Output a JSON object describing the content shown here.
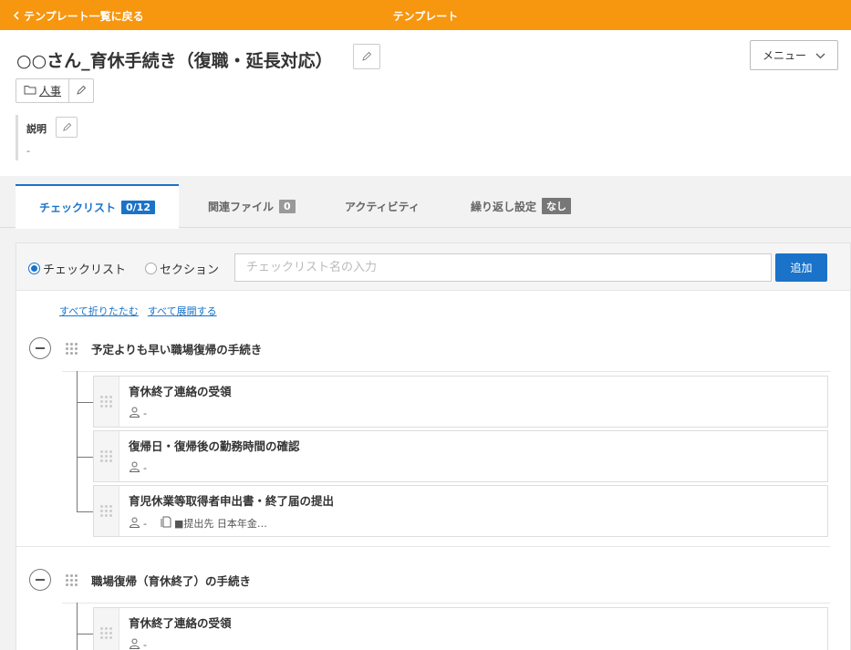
{
  "topbar": {
    "back_label": "テンプレート一覧に戻る",
    "title": "テンプレート"
  },
  "header": {
    "title": "○○さん_育休手続き（復職・延長対応）",
    "menu_label": "メニュー",
    "category": "人事",
    "description_label": "説明",
    "description_value": "-"
  },
  "tabs": [
    {
      "label": "チェックリスト",
      "badge": "0/12"
    },
    {
      "label": "関連ファイル",
      "badge": "0"
    },
    {
      "label": "アクティビティ",
      "badge": ""
    },
    {
      "label": "繰り返し設定",
      "badge": "なし"
    }
  ],
  "addbar": {
    "radio_checklist": "チェックリスト",
    "radio_section": "セクション",
    "input_placeholder": "チェックリスト名の入力",
    "add_label": "追加"
  },
  "links": {
    "collapse_all": "すべて折りたたむ",
    "expand_all": "すべて展開する"
  },
  "sections": [
    {
      "title": "予定よりも早い職場復帰の手続き",
      "items": [
        {
          "name": "育休終了連絡の受領",
          "assignee": "-",
          "file": ""
        },
        {
          "name": "復帰日・復帰後の勤務時間の確認",
          "assignee": "-",
          "file": ""
        },
        {
          "name": "育児休業等取得者申出書・終了届の提出",
          "assignee": "-",
          "file": "■提出先 日本年金…"
        }
      ]
    },
    {
      "title": "職場復帰（育休終了）の手続き",
      "items": [
        {
          "name": "育休終了連絡の受領",
          "assignee": "-",
          "file": ""
        }
      ]
    }
  ],
  "colors": {
    "topbar": "#f7960f",
    "accent": "#1a73c9"
  }
}
